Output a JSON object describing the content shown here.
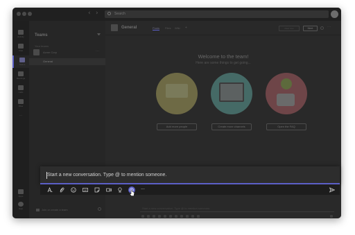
{
  "app": {
    "search_placeholder": "Search"
  },
  "rail": {
    "items": [
      {
        "label": "Activity",
        "icon": "bell-icon"
      },
      {
        "label": "Chat",
        "icon": "chat-icon"
      },
      {
        "label": "Teams",
        "icon": "teams-icon",
        "active": true
      },
      {
        "label": "Meetings",
        "icon": "calendar-icon"
      },
      {
        "label": "Calls",
        "icon": "phone-icon"
      },
      {
        "label": "Files",
        "icon": "file-icon"
      },
      {
        "label": "...",
        "icon": "more-icon"
      },
      {
        "label": "Apps",
        "icon": "apps-icon"
      },
      {
        "label": "Help",
        "icon": "help-icon"
      }
    ]
  },
  "teams_panel": {
    "title": "Teams",
    "section_label": "Your teams",
    "team_name": "Acme Corp",
    "team_more": "···",
    "channel": "General",
    "join_label": "Join or create a team"
  },
  "channel": {
    "title": "General",
    "tabs": [
      "Posts",
      "Files",
      "Wiki",
      "+"
    ],
    "active_tab": "Posts",
    "meet_now_ghost": "Meet now",
    "meet_label": "Meet"
  },
  "welcome": {
    "title": "Welcome to the team!",
    "subtitle": "Here are some things to get going...",
    "actions": [
      "Add more people",
      "Create more channels",
      "Open the FAQ"
    ]
  },
  "composer": {
    "placeholder": "Start a new conversation. Type @ to mention someone.",
    "ghost_placeholder": "Start a new conversation. Type @ to mention someone.",
    "toolbar": [
      {
        "name": "format-icon",
        "glyph": "A"
      },
      {
        "name": "attach-icon",
        "glyph": "📎"
      },
      {
        "name": "emoji-icon",
        "glyph": "☺"
      },
      {
        "name": "gif-icon",
        "glyph": "GIF"
      },
      {
        "name": "sticker-icon",
        "glyph": "▭"
      },
      {
        "name": "meet-now-icon",
        "glyph": "▷"
      },
      {
        "name": "praise-icon",
        "glyph": "♀"
      },
      {
        "name": "app-icon",
        "glyph": "◉"
      },
      {
        "name": "more-options-icon",
        "glyph": "···"
      }
    ],
    "send_icon": "send-icon"
  },
  "colors": {
    "accent": "#5b5fc7",
    "window_bg": "#2a2a2a",
    "compose_bg": "#2d2d2d",
    "toolbar_bg": "#1d1d1d",
    "illus_yellow": "#6e6a45",
    "illus_teal": "#456a66",
    "illus_red": "#6e4548"
  }
}
